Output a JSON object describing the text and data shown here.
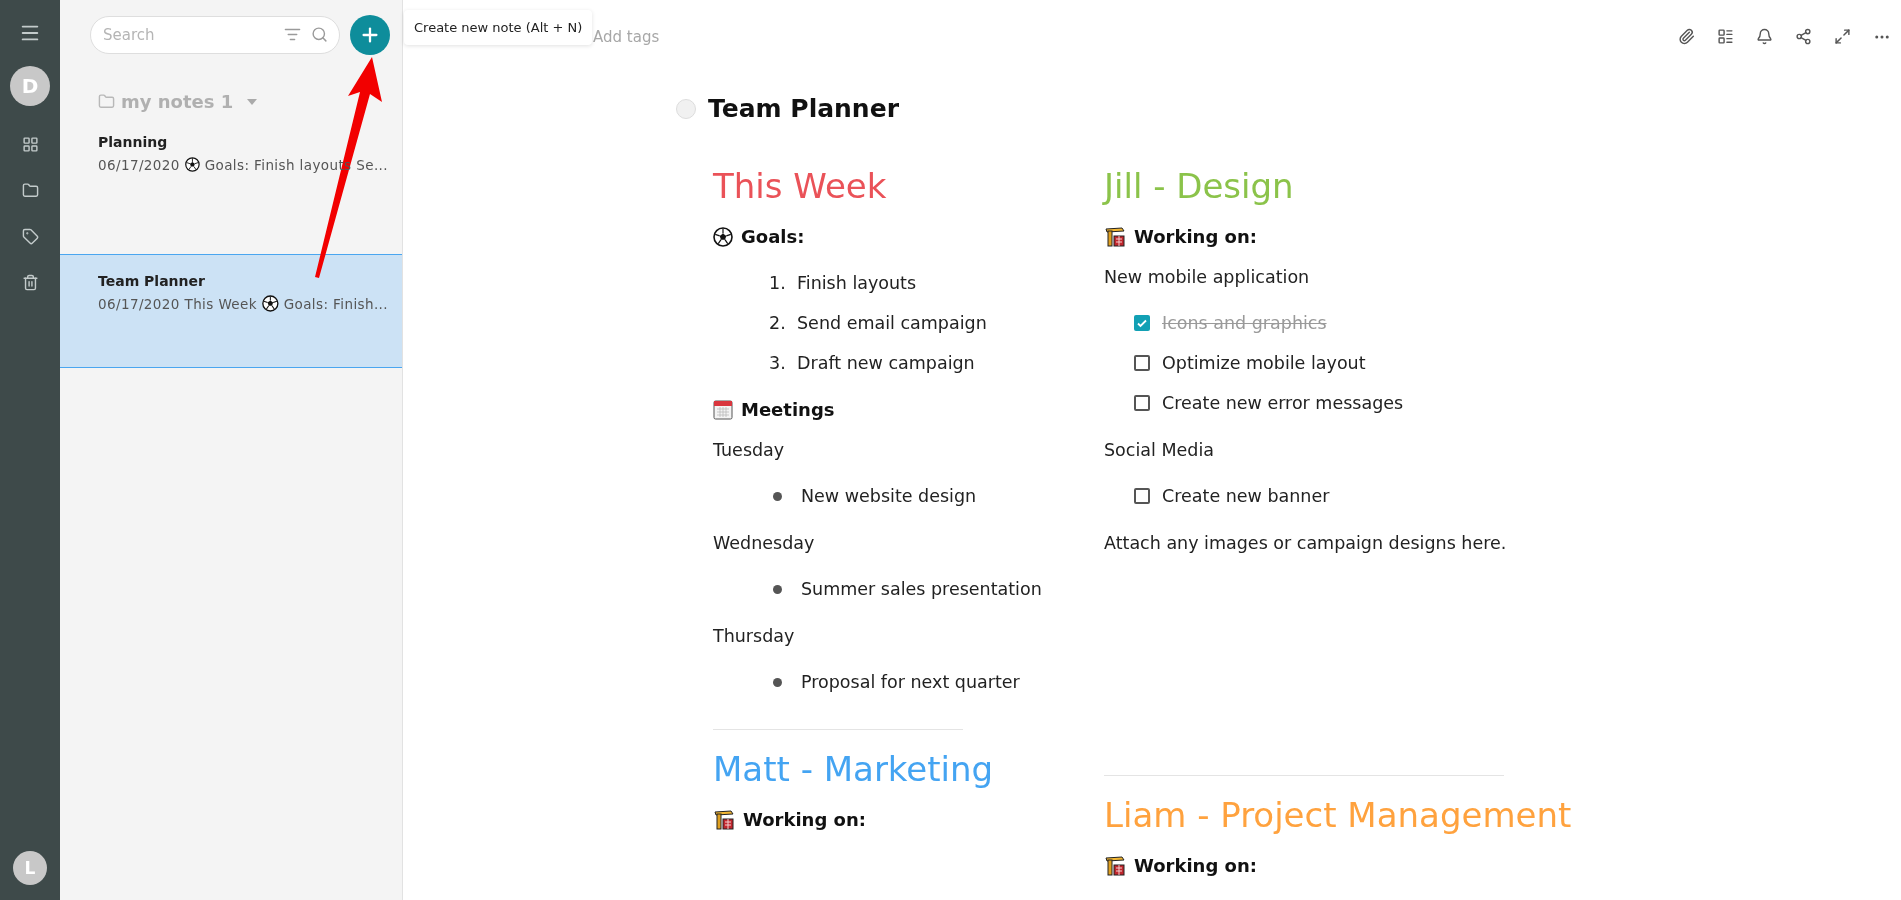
{
  "sidebar": {
    "user_avatar": "D",
    "bottom_avatar": "L"
  },
  "notes_panel": {
    "search": {
      "placeholder": "Search"
    },
    "new_note_tooltip": "Create new note (Alt + N)",
    "folder": "my notes 1",
    "notes": [
      {
        "title": "Planning",
        "preview_start": "06/17/2020",
        "preview_end": "Goals: Finish layouts Se...",
        "selected": false
      },
      {
        "title": "Team Planner",
        "preview_start": "06/17/2020 This Week",
        "preview_end": "Goals: Finish...",
        "selected": true
      }
    ]
  },
  "editor": {
    "tags_placeholder": "Add tags",
    "title": "Team Planner",
    "columns": [
      {
        "blocks": [
          {
            "kind": "heading",
            "text": "This Week",
            "color": "#ea5258"
          },
          {
            "kind": "goals",
            "text": "Goals:"
          },
          {
            "kind": "ordered",
            "items": [
              {
                "number": "1.",
                "text": "Finish layouts"
              },
              {
                "number": "2.",
                "text": "Send email campaign"
              },
              {
                "number": "3.",
                "text": "Draft new campaign"
              }
            ]
          },
          {
            "kind": "meetings",
            "text": "Meetings"
          },
          {
            "kind": "paragraph",
            "text": "Tuesday"
          },
          {
            "kind": "bullets",
            "items": [
              "New website design"
            ]
          },
          {
            "kind": "paragraph",
            "text": "Wednesday"
          },
          {
            "kind": "bullets",
            "items": [
              "Summer sales presentation"
            ]
          },
          {
            "kind": "paragraph",
            "text": "Thursday"
          },
          {
            "kind": "bullets",
            "items": [
              "Proposal for next quarter"
            ]
          },
          {
            "kind": "rule"
          },
          {
            "kind": "heading",
            "text": "Matt - Marketing",
            "color": "#44a4f2"
          },
          {
            "kind": "tasks",
            "text": "Working on:"
          }
        ]
      },
      {
        "blocks": [
          {
            "kind": "heading",
            "text": "Jill - Design",
            "color": "#8bc34a"
          },
          {
            "kind": "tasks",
            "text": "Working on:"
          },
          {
            "kind": "paragraph",
            "text": "New mobile application"
          },
          {
            "kind": "checklist",
            "items": [
              {
                "text": "Icons and graphics",
                "checked": true
              },
              {
                "text": "Optimize mobile layout",
                "checked": false
              },
              {
                "text": "Create new error messages",
                "checked": false
              }
            ]
          },
          {
            "kind": "paragraph",
            "text": "Social Media"
          },
          {
            "kind": "checklist",
            "items": [
              {
                "text": "Create new banner",
                "checked": false
              }
            ]
          },
          {
            "kind": "paragraph",
            "text": "Attach any images or campaign designs here."
          },
          {
            "kind": "rule"
          },
          {
            "kind": "heading",
            "text": "Liam - Project Management",
            "color": "#ffa23e"
          },
          {
            "kind": "tasks",
            "text": "Working on:"
          }
        ]
      }
    ]
  }
}
